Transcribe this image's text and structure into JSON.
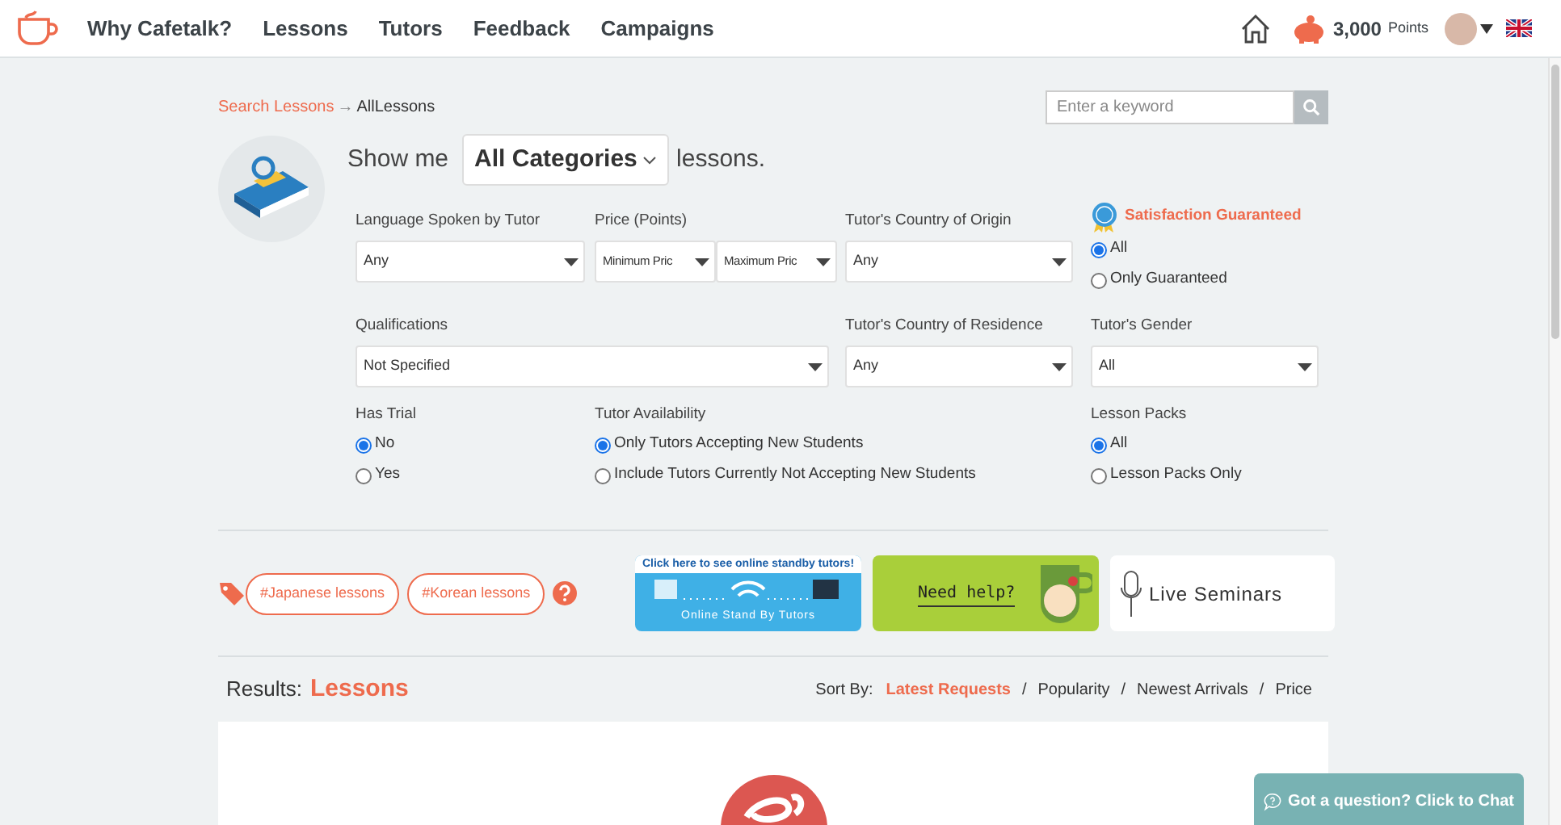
{
  "nav": {
    "items": [
      "Why Cafetalk?",
      "Lessons",
      "Tutors",
      "Feedback",
      "Campaigns"
    ]
  },
  "account": {
    "points": "3,000",
    "points_unit": "Points"
  },
  "breadcrumb": {
    "link": "Search Lessons",
    "separator": "→",
    "current": "AllLessons"
  },
  "search": {
    "placeholder": "Enter a keyword"
  },
  "category": {
    "prefix": "Show me",
    "value": "All Categories",
    "suffix": "lessons."
  },
  "filters": {
    "language": {
      "label": "Language Spoken by Tutor",
      "value": "Any"
    },
    "price": {
      "label": "Price (Points)",
      "min": "Minimum Pric",
      "max": "Maximum Pric"
    },
    "origin": {
      "label": "Tutor's Country of Origin",
      "value": "Any"
    },
    "satisfaction": {
      "label": "Satisfaction Guaranteed",
      "options": [
        {
          "label": "All",
          "selected": true
        },
        {
          "label": "Only Guaranteed",
          "selected": false
        }
      ]
    },
    "qualifications": {
      "label": "Qualifications",
      "value": "Not Specified"
    },
    "residence": {
      "label": "Tutor's Country of Residence",
      "value": "Any"
    },
    "gender": {
      "label": "Tutor's Gender",
      "value": "All"
    },
    "trial": {
      "label": "Has Trial",
      "options": [
        {
          "label": "No",
          "selected": true
        },
        {
          "label": "Yes",
          "selected": false
        }
      ]
    },
    "availability": {
      "label": "Tutor Availability",
      "options": [
        {
          "label": "Only Tutors Accepting New Students",
          "selected": true
        },
        {
          "label": "Include Tutors Currently Not Accepting New Students",
          "selected": false
        }
      ]
    },
    "packs": {
      "label": "Lesson Packs",
      "options": [
        {
          "label": "All",
          "selected": true
        },
        {
          "label": "Lesson Packs Only",
          "selected": false
        }
      ]
    }
  },
  "tags": [
    "#Japanese lessons",
    "#Korean lessons"
  ],
  "banners": [
    {
      "kind": "standby",
      "top": "Click here to see online standby tutors!",
      "bottom": "Online Stand By Tutors"
    },
    {
      "kind": "help",
      "text": "Need help?"
    },
    {
      "kind": "seminar",
      "text": "Live Seminars"
    }
  ],
  "results": {
    "label": "Results:",
    "value": "Lessons"
  },
  "sort": {
    "label": "Sort By:",
    "separator": "/",
    "options": [
      {
        "label": "Latest Requests",
        "selected": true
      },
      {
        "label": "Popularity",
        "selected": false
      },
      {
        "label": "Newest Arrivals",
        "selected": false
      },
      {
        "label": "Price",
        "selected": false
      }
    ]
  },
  "chat": {
    "label": "Got a question? Click to Chat"
  }
}
